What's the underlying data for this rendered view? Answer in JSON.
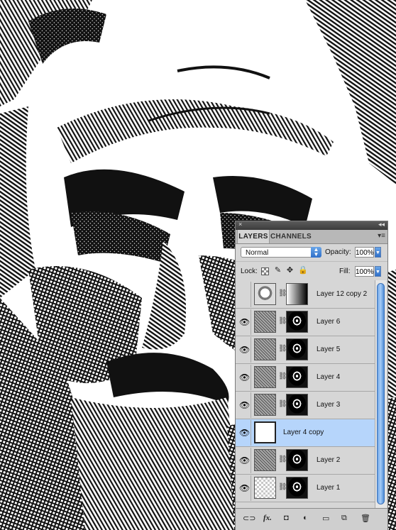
{
  "panel": {
    "tabs": [
      "LAYERS",
      "CHANNELS"
    ],
    "blend_mode": "Normal",
    "opacity_label": "Opacity:",
    "opacity_value": "100%",
    "lock_label": "Lock:",
    "fill_label": "Fill:",
    "fill_value": "100%",
    "fx_label": "fx."
  },
  "layers": [
    {
      "name": "Layer 12 copy 2",
      "visible": false,
      "thumb": "face",
      "mask": "gradient",
      "selected": false
    },
    {
      "name": "Layer 6",
      "visible": true,
      "thumb": "pattern",
      "mask": "dark",
      "selected": false
    },
    {
      "name": "Layer 5",
      "visible": true,
      "thumb": "pattern",
      "mask": "dark",
      "selected": false
    },
    {
      "name": "Layer 4",
      "visible": true,
      "thumb": "pattern",
      "mask": "dark",
      "selected": false
    },
    {
      "name": "Layer 3",
      "visible": true,
      "thumb": "pattern",
      "mask": "dark",
      "selected": false
    },
    {
      "name": "Layer 4 copy",
      "visible": true,
      "thumb": "white",
      "mask": null,
      "selected": true
    },
    {
      "name": "Layer 2",
      "visible": true,
      "thumb": "pattern",
      "mask": "dark",
      "selected": false
    },
    {
      "name": "Layer 1",
      "visible": true,
      "thumb": "checker",
      "mask": "dark",
      "selected": false
    }
  ],
  "colors": {
    "selection": "#b6d5fb",
    "panel_bg": "#d6d6d6",
    "accent_blue": "#2f6fc9"
  }
}
